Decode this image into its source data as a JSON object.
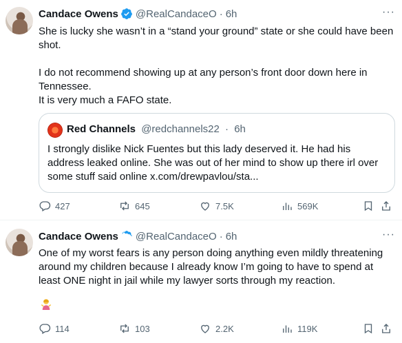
{
  "tweets": [
    {
      "author_name": "Candace Owens",
      "handle": "@RealCandaceO",
      "separator": "·",
      "time": "6h",
      "more": "···",
      "paragraphs": [
        "She is lucky she wasn’t in a “stand your ground” state or she could have been shot.",
        "I do not recommend showing up at any person’s front door down here in Tennessee.",
        "It is very much a FAFO state."
      ],
      "quote": {
        "author_name": "Red Channels",
        "handle": "@redchannels22",
        "separator": "·",
        "time": "6h",
        "text": "I strongly dislike Nick Fuentes but this lady deserved it. He had his address leaked online. She was out of her mind to show up there irl over some stuff said online x.com/drewpavlou/sta..."
      },
      "stats": {
        "replies": "427",
        "reposts": "645",
        "likes": "7.5K",
        "views": "569K"
      }
    },
    {
      "author_name": "Candace Owens",
      "handle": "@RealCandaceO",
      "separator": "·",
      "time": "6h",
      "more": "···",
      "paragraphs": [
        "One of my worst fears is any person doing anything even mildly threatening around my children because I already know I’m going to have to spend at least ONE night in jail while my lawyer sorts through my reaction."
      ],
      "emoji": "person-shrugging-emoji",
      "stats": {
        "replies": "114",
        "reposts": "103",
        "likes": "2.2K",
        "views": "119K"
      }
    }
  ],
  "colors": {
    "verified_blue": "#1d9bf0",
    "secondary_text": "#536471",
    "border": "#cfd9de"
  }
}
